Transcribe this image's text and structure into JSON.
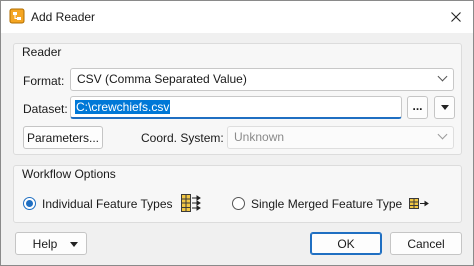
{
  "window": {
    "title": "Add Reader",
    "close_icon": "close-icon",
    "app_icon": "fme-app-icon"
  },
  "reader_group": {
    "title": "Reader",
    "format_label": "Format:",
    "format_value": "CSV (Comma Separated Value)",
    "dataset_label": "Dataset:",
    "dataset_value": "C:\\crewchiefs.csv",
    "browse_label": "...",
    "parameters_label": "Parameters...",
    "coord_system_label": "Coord. System:",
    "coord_system_value": "Unknown"
  },
  "workflow_group": {
    "title": "Workflow Options",
    "option_individual": "Individual Feature Types",
    "option_single": "Single Merged Feature Type",
    "selected_option": "Individual Feature Types"
  },
  "footer": {
    "help_label": "Help",
    "ok_label": "OK",
    "cancel_label": "Cancel"
  },
  "colors": {
    "accent": "#1f6fc2",
    "selection": "#0078d7",
    "dialog_bg": "#f0f0f0"
  }
}
